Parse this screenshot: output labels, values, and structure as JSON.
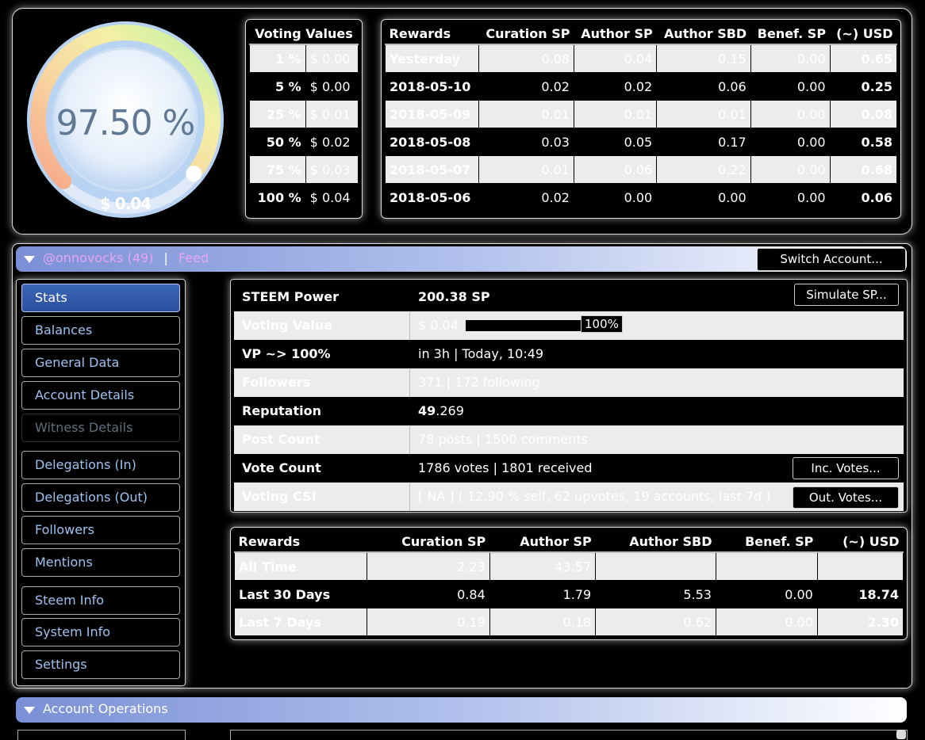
{
  "gauge": {
    "percent_label": "97.50 %",
    "value_label": "$ 0.04",
    "level": 0.975
  },
  "voting_values": {
    "header": "Voting Values",
    "rows": [
      {
        "pct": "1 %",
        "usd": "$ 0.00"
      },
      {
        "pct": "5 %",
        "usd": "$ 0.00"
      },
      {
        "pct": "25 %",
        "usd": "$ 0.01"
      },
      {
        "pct": "50 %",
        "usd": "$ 0.02"
      },
      {
        "pct": "75 %",
        "usd": "$ 0.03"
      },
      {
        "pct": "100 %",
        "usd": "$ 0.04"
      }
    ]
  },
  "daily_rewards": {
    "headers": [
      "Rewards",
      "Curation SP",
      "Author SP",
      "Author SBD",
      "Benef. SP",
      "(~) USD"
    ],
    "rows": [
      [
        "Yesterday",
        "0.08",
        "0.04",
        "0.15",
        "0.00",
        "0.65"
      ],
      [
        "2018-05-10",
        "0.02",
        "0.02",
        "0.06",
        "0.00",
        "0.25"
      ],
      [
        "2018-05-09",
        "0.01",
        "0.01",
        "0.01",
        "0.00",
        "0.08"
      ],
      [
        "2018-05-08",
        "0.03",
        "0.05",
        "0.17",
        "0.00",
        "0.58"
      ],
      [
        "2018-05-07",
        "0.01",
        "0.06",
        "0.22",
        "0.00",
        "0.68"
      ],
      [
        "2018-05-06",
        "0.02",
        "0.00",
        "0.00",
        "0.00",
        "0.06"
      ]
    ]
  },
  "account": {
    "name": "@onnovocks (49)",
    "divider": "|",
    "feed_label": "Feed",
    "switch_label": "Switch Account..."
  },
  "sidebar": {
    "items": [
      "Stats",
      "Balances",
      "General Data",
      "Account Details",
      "Witness Details",
      "Delegations (In)",
      "Delegations (Out)",
      "Followers",
      "Mentions",
      "Steem Info",
      "System Info",
      "Settings"
    ]
  },
  "stats": {
    "steem_power": {
      "label": "STEEM Power",
      "value": "200.38 SP",
      "button": "Simulate SP..."
    },
    "voting_value": {
      "label": "Voting Value",
      "value": "$ 0.04",
      "bar_label": "100%",
      "level": 1.0
    },
    "vp": {
      "label": "VP ~> 100%",
      "value": "in 3h | Today, 10:49"
    },
    "followers": {
      "label": "Followers",
      "value": "371 | 172 following"
    },
    "reputation": {
      "label": "Reputation",
      "value_bold": "49",
      "value_rest": ".269"
    },
    "post_count": {
      "label": "Post Count",
      "value": "78 posts | 1500 comments"
    },
    "vote_count": {
      "label": "Vote Count",
      "value": "1786 votes | 1801 received",
      "button": "Inc. Votes..."
    },
    "voting_csi": {
      "label": "Voting CSI",
      "value": "[ NA ] ( 12.90 % self, 62 upvotes, 19 accounts, last 7d )",
      "button": "Out. Votes..."
    }
  },
  "period_rewards": {
    "headers": [
      "Rewards",
      "Curation SP",
      "Author SP",
      "Author SBD",
      "Benef. SP",
      "(~) USD"
    ],
    "rows": [
      [
        "All Time",
        "2.23",
        "43.57",
        "",
        "",
        ""
      ],
      [
        "Last 30 Days",
        "0.84",
        "1.79",
        "5.53",
        "0.00",
        "18.74"
      ],
      [
        "Last 7 Days",
        "0.19",
        "0.18",
        "0.62",
        "0.00",
        "2.30"
      ]
    ]
  },
  "operations": {
    "title": "Account Operations"
  }
}
